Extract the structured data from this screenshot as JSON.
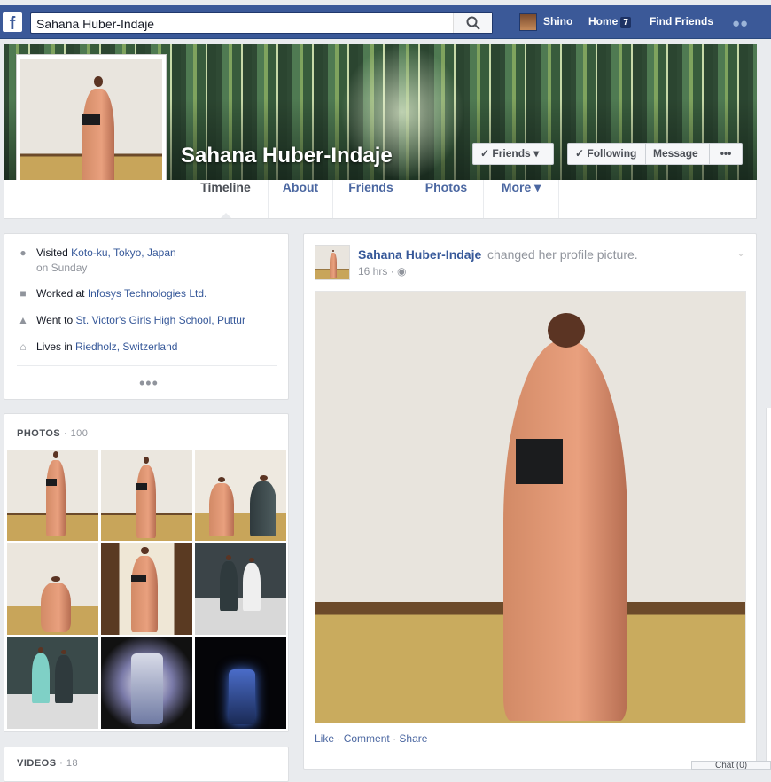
{
  "topbar": {
    "logo": "f",
    "search_value": "Sahana Huber-Indaje",
    "user_name": "Shino",
    "home_label": "Home",
    "home_badge": "7",
    "find_friends_label": "Find Friends",
    "search_icon": "magnifier-icon",
    "friends_icon": "friend-requests-icon"
  },
  "profile": {
    "name": "Sahana Huber-Indaje",
    "buttons": {
      "friends": "Friends",
      "following": "Following",
      "message": "Message",
      "more": "•••"
    },
    "tabs": [
      "Timeline",
      "About",
      "Friends",
      "Photos",
      "More"
    ]
  },
  "about": {
    "visited_prefix": "Visited",
    "visited_place": "Koto-ku, Tokyo, Japan",
    "visited_when": "on Sunday",
    "worked_prefix": "Worked at",
    "worked_place": "Infosys Technologies Ltd.",
    "went_prefix": "Went to",
    "went_place": "St. Victor's Girls High School, Puttur",
    "lives_prefix": "Lives in",
    "lives_place": "Riedholz, Switzerland",
    "more": "•••"
  },
  "photos": {
    "label": "PHOTOS",
    "separator": "·",
    "count": "100"
  },
  "videos": {
    "label": "VIDEOS",
    "separator": "·",
    "count": "18"
  },
  "post": {
    "author": "Sahana Huber-Indaje",
    "action": "changed her profile picture.",
    "time": "16 hrs",
    "actions": [
      "Like",
      "Comment",
      "Share"
    ],
    "separator": "·"
  },
  "chat": {
    "label": "Chat (0)"
  },
  "colors": {
    "brand": "#3b5998",
    "link": "#365899",
    "meta": "#90949c"
  }
}
